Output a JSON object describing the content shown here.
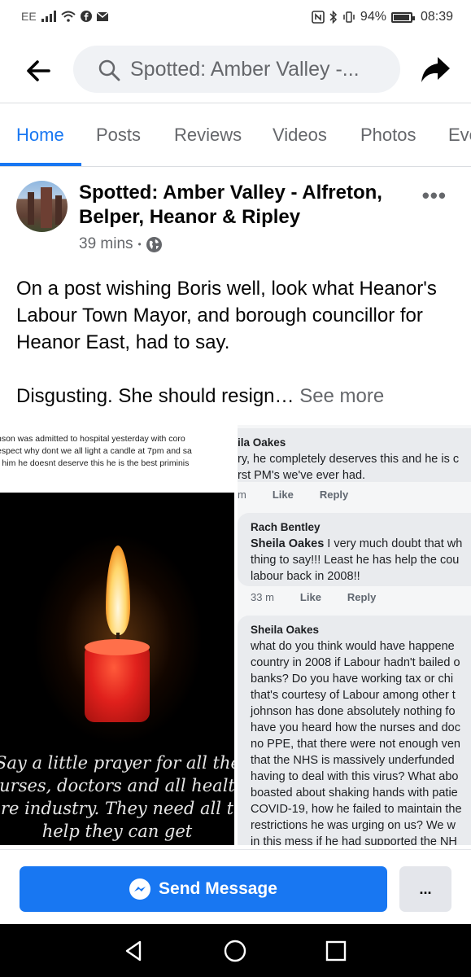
{
  "status_bar": {
    "carrier": "EE",
    "battery_percent": "94%",
    "time": "08:39",
    "icons": [
      "signal-icon",
      "wifi-icon",
      "facebook-icon",
      "mail-icon",
      "nfc-icon",
      "bluetooth-icon",
      "vibrate-icon",
      "battery-icon"
    ]
  },
  "top_bar": {
    "search_text": "Spotted: Amber Valley -...",
    "back_icon": "back-arrow-icon",
    "share_icon": "share-icon"
  },
  "tabs": [
    {
      "label": "Home",
      "active": true
    },
    {
      "label": "Posts",
      "active": false
    },
    {
      "label": "Reviews",
      "active": false
    },
    {
      "label": "Videos",
      "active": false
    },
    {
      "label": "Photos",
      "active": false
    },
    {
      "label": "Eve",
      "active": false
    }
  ],
  "post": {
    "page_name": "Spotted: Amber Valley - Alfreton, Belper, Heanor & Ripley",
    "time": "39 mins",
    "separator": "•",
    "privacy_icon": "globe-icon",
    "text_p1": "On a post wishing Boris well, look what Heanor's Labour Town Mayor, and borough councillor for Heanor East, had to say.",
    "text_p2": "Disgusting. She should resign… ",
    "see_more": "See more"
  },
  "image_left": {
    "caption_lines": [
      "nson was admitted to  hospital yesterday with coro",
      "espect why dont we all light a candle at 7pm and sa",
      "r him he doesnt deserve this he is the best priminis"
    ],
    "prayer_lines": [
      "Say a little prayer for all the",
      "urses, doctors and all healt",
      "re industry. They need all t",
      "help they can get"
    ]
  },
  "image_right": {
    "comment1": {
      "name": "ila Oakes",
      "lines": [
        "ry, he completely deserves this and he is c",
        "rst PM's we've ever had."
      ]
    },
    "actions1": {
      "time": "m",
      "like": "Like",
      "reply": "Reply"
    },
    "comment2": {
      "name": "Rach Bentley",
      "mention": "Sheila Oakes",
      "line1_rest": " I very much doubt that wh",
      "lines": [
        "thing to say!!! Least he has help the cou",
        "labour back in 2008!!"
      ]
    },
    "actions2": {
      "time": "33 m",
      "like": "Like",
      "reply": "Reply"
    },
    "comment3": {
      "name": "Sheila Oakes",
      "lines": [
        "what do you think would have happene",
        "country in 2008 if Labour hadn't bailed o",
        "banks?  Do you have working tax or chi",
        "that's courtesy of Labour among other t",
        "johnson has done absolutely nothing fo",
        "have you heard how the nurses and doc",
        "no PPE, that there were not enough ven",
        "that the NHS is massively underfunded",
        "having to deal with this virus?  What abo",
        "boasted about shaking hands with patie",
        "COVID-19, how he failed to maintain the",
        "restrictions he was urging on us?  We w",
        "in this mess if he had supported the NH"
      ]
    }
  },
  "bottom_bar": {
    "send_message": "Send Message",
    "more": "..."
  },
  "nav": {
    "icons": [
      "back-triangle-icon",
      "home-circle-icon",
      "recents-square-icon"
    ]
  }
}
